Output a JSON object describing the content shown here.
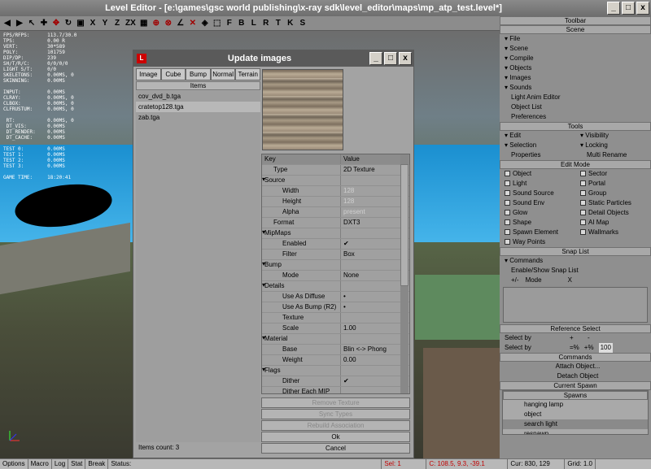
{
  "window": {
    "title": "Level Editor - [e:\\games\\gsc world publishing\\x-ray sdk\\level_editor\\maps\\mp_atp_test.level*]",
    "min": "_",
    "max": "□",
    "close": "x"
  },
  "toolbar": {
    "axis_x": "X",
    "axis_y": "Y",
    "axis_z": "Z",
    "axis_zx": "ZX",
    "snap_f": "F",
    "snap_b": "B",
    "snap_l": "L",
    "snap_r": "R",
    "snap_t": "T",
    "snap_k": "K",
    "snap_s": "S"
  },
  "stats": "FPS/RFPS:      113.7/30.0\nTPS:           0.00 R\nVERT:          30*589\nPOLY:          101759\nDIP/DP:        239\nSH/T/R/C:      0/0/0/0\nLIGHT S/T:     0/0\nSKELETONS:     0.00MS, 0\nSKINNING:      0.00MS\n\nINPUT:         0.00MS\nCLRAY:         0.00MS, 0\nCLBOX:         0.00MS, 0\nCLFRUSTUM:     0.00MS, 0\n\n RT:           0.00MS, 0\n DT_VIS:       0.00MS\n DT_RENDER:    0.00MS\n DT_CACHE:     0.00MS\n\nTEST 0:        0.00MS\nTEST 1:        0.00MS\nTEST 2:        0.00MS\nTEST 3:        0.00MS\n\nGAME TIME:     18:20:41",
  "dialog": {
    "title": "Update images",
    "icon": "L",
    "tabs": [
      "Image",
      "Cube",
      "Bump",
      "Normal",
      "Terrain"
    ],
    "items_header": "Items",
    "items": [
      "cov_dvd_b.tga",
      "cratetop128.tga",
      "zab.tga"
    ],
    "selected_index": 1,
    "count": "Items count: 3",
    "grid_headers": {
      "key": "Key",
      "value": "Value"
    },
    "props": [
      {
        "k": "Type",
        "v": "2D Texture",
        "dots": true,
        "lvl": 1
      },
      {
        "k": "Source",
        "v": "",
        "grp": true
      },
      {
        "k": "Width",
        "v": "128",
        "lvl": 2,
        "dis": true
      },
      {
        "k": "Height",
        "v": "128",
        "lvl": 2,
        "dis": true
      },
      {
        "k": "Alpha",
        "v": "present",
        "lvl": 2,
        "dis": true
      },
      {
        "k": "Format",
        "v": "DXT3",
        "dots": true,
        "lvl": 1
      },
      {
        "k": "MipMaps",
        "v": "",
        "grp": true
      },
      {
        "k": "Enabled",
        "v": "✔",
        "lvl": 2
      },
      {
        "k": "Filter",
        "v": "Box",
        "dots": true,
        "lvl": 2
      },
      {
        "k": "Bump",
        "v": "",
        "grp": true
      },
      {
        "k": "Mode",
        "v": "None",
        "dots": true,
        "lvl": 2
      },
      {
        "k": "Details",
        "v": "",
        "grp": true
      },
      {
        "k": "Use As Diffuse",
        "v": "•",
        "lvl": 2
      },
      {
        "k": "Use As Bump (R2)",
        "v": "•",
        "lvl": 2
      },
      {
        "k": "Texture",
        "v": "",
        "dots": true,
        "lvl": 2
      },
      {
        "k": "Scale",
        "v": "1.00",
        "lvl": 2
      },
      {
        "k": "Material",
        "v": "",
        "grp": true
      },
      {
        "k": "Base",
        "v": "Blin <-> Phong",
        "dots": true,
        "lvl": 2
      },
      {
        "k": "Weight",
        "v": "0.00",
        "lvl": 2
      },
      {
        "k": "Flags",
        "v": "",
        "grp": true
      },
      {
        "k": "Dither",
        "v": "✔",
        "lvl": 2
      },
      {
        "k": "Dither Each MIP",
        "v": "",
        "lvl": 2
      }
    ],
    "buttons": {
      "remove": "Remove Texture",
      "sync": "Sync Types",
      "rebuild": "Rebuild Association",
      "ok": "Ok",
      "cancel": "Cancel"
    }
  },
  "panel": {
    "title": "Toolbar",
    "scene": {
      "header": "Scene",
      "items": [
        "File",
        "Scene",
        "Compile",
        "Objects",
        "Images",
        "Sounds"
      ],
      "plain": [
        "Light Anim Editor",
        "Object List",
        "Preferences"
      ]
    },
    "tools": {
      "header": "Tools",
      "edit": "Edit",
      "visibility": "Visibility",
      "selection": "Selection",
      "locking": "Locking",
      "properties": "Properties",
      "multi_rename": "Multi Rename"
    },
    "edit_mode": {
      "header": "Edit Mode",
      "left": [
        "Object",
        "Light",
        "Sound Source",
        "Sound Env",
        "Glow",
        "Shape",
        "Spawn Element",
        "Way Points"
      ],
      "right": [
        "Sector",
        "Portal",
        "Group",
        "Static Particles",
        "Detail Objects",
        "AI Map",
        "Wallmarks"
      ]
    },
    "snap": {
      "header": "Snap List",
      "commands": "Commands",
      "enable": "Enable/Show Snap List",
      "plusminus": "+/-",
      "mode": "Mode",
      "x": "X"
    },
    "ref": {
      "header": "Reference Select",
      "select_by_1": "Select by",
      "plus": "+",
      "minus": "-",
      "select_by_2": "Select by",
      "eq_pct": "=%",
      "plus_pct": "+%",
      "value": "100"
    },
    "commands": {
      "header": "Commands",
      "attach": "Attach Object...",
      "detach": "Detach Object"
    },
    "spawn": {
      "header": "Current Spawn",
      "list_header": "Spawns",
      "items": [
        "hanging lamp",
        "object",
        "search light",
        "respawn"
      ],
      "selected": 2
    }
  },
  "status": {
    "options": "Options",
    "macro": "Macro",
    "log": "Log",
    "stat": "Stat",
    "break": "Break",
    "status": "Status:",
    "sel": "Sel: 1",
    "c": "C: 108.5, 9.3, -39.1",
    "cur": "Cur: 830, 129",
    "grid": "Grid: 1.0"
  }
}
